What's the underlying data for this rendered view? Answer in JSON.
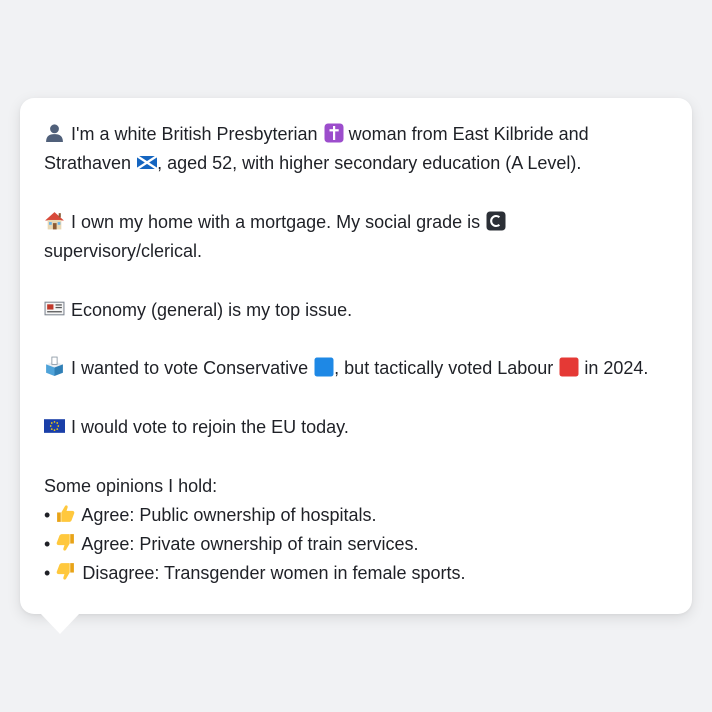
{
  "profile": {
    "identity": {
      "icon": "person-silhouette-icon",
      "text_before": "I'm a white British Presbyterian",
      "religion_icon": "latin-cross-icon",
      "text_middle": "woman from East Kilbride and Strathaven",
      "flag_icon": "scotland-flag-icon",
      "text_after": ", aged 52, with higher secondary education (A Level)."
    },
    "housing": {
      "icon": "house-icon",
      "text_before": "I own my home with a mortgage. My social grade is",
      "grade_icon": "letter-c-icon",
      "text_after": "supervisory/clerical."
    },
    "issue": {
      "icon": "newspaper-icon",
      "text": "Economy (general) is my top issue."
    },
    "vote": {
      "icon": "ballot-box-icon",
      "text_before": "I wanted to vote Conservative",
      "party1_icon": "blue-square-icon",
      "text_middle": ", but tactically voted Labour",
      "party2_icon": "red-square-icon",
      "text_after": "in 2024."
    },
    "eu": {
      "icon": "eu-flag-icon",
      "text": "I would vote to rejoin the EU today."
    },
    "opinions_heading": "Some opinions I hold:",
    "opinions": [
      {
        "bullet": "•",
        "icon": "thumbs-up-icon",
        "text": "Agree: Public ownership of hospitals."
      },
      {
        "bullet": "•",
        "icon": "thumbs-down-icon",
        "text": "Agree: Private ownership of train services."
      },
      {
        "bullet": "•",
        "icon": "thumbs-down-icon",
        "text": "Disagree: Transgender women in female sports."
      }
    ]
  },
  "colors": {
    "background": "#f1f2f4",
    "card": "#ffffff",
    "text": "#1f2127",
    "conservative_blue": "#1e88e5",
    "labour_red": "#e53935",
    "cross_purple": "#9c4dcc",
    "thumb_yellow": "#ffc83d"
  }
}
